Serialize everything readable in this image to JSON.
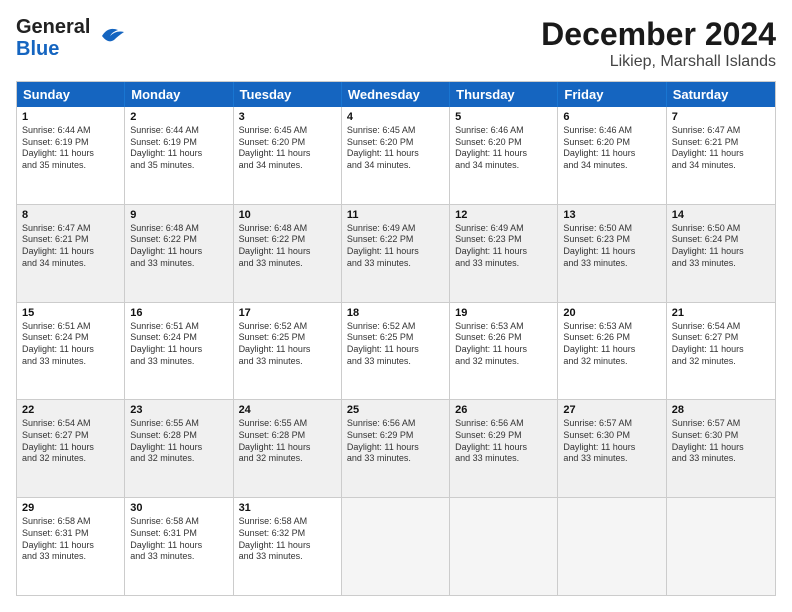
{
  "header": {
    "logo_general": "General",
    "logo_blue": "Blue",
    "month": "December 2024",
    "location": "Likiep, Marshall Islands"
  },
  "days": [
    "Sunday",
    "Monday",
    "Tuesday",
    "Wednesday",
    "Thursday",
    "Friday",
    "Saturday"
  ],
  "weeks": [
    [
      {
        "day": "1",
        "info": "Sunrise: 6:44 AM\nSunset: 6:19 PM\nDaylight: 11 hours\nand 35 minutes."
      },
      {
        "day": "2",
        "info": "Sunrise: 6:44 AM\nSunset: 6:19 PM\nDaylight: 11 hours\nand 35 minutes."
      },
      {
        "day": "3",
        "info": "Sunrise: 6:45 AM\nSunset: 6:20 PM\nDaylight: 11 hours\nand 34 minutes."
      },
      {
        "day": "4",
        "info": "Sunrise: 6:45 AM\nSunset: 6:20 PM\nDaylight: 11 hours\nand 34 minutes."
      },
      {
        "day": "5",
        "info": "Sunrise: 6:46 AM\nSunset: 6:20 PM\nDaylight: 11 hours\nand 34 minutes."
      },
      {
        "day": "6",
        "info": "Sunrise: 6:46 AM\nSunset: 6:20 PM\nDaylight: 11 hours\nand 34 minutes."
      },
      {
        "day": "7",
        "info": "Sunrise: 6:47 AM\nSunset: 6:21 PM\nDaylight: 11 hours\nand 34 minutes."
      }
    ],
    [
      {
        "day": "8",
        "info": "Sunrise: 6:47 AM\nSunset: 6:21 PM\nDaylight: 11 hours\nand 34 minutes."
      },
      {
        "day": "9",
        "info": "Sunrise: 6:48 AM\nSunset: 6:22 PM\nDaylight: 11 hours\nand 33 minutes."
      },
      {
        "day": "10",
        "info": "Sunrise: 6:48 AM\nSunset: 6:22 PM\nDaylight: 11 hours\nand 33 minutes."
      },
      {
        "day": "11",
        "info": "Sunrise: 6:49 AM\nSunset: 6:22 PM\nDaylight: 11 hours\nand 33 minutes."
      },
      {
        "day": "12",
        "info": "Sunrise: 6:49 AM\nSunset: 6:23 PM\nDaylight: 11 hours\nand 33 minutes."
      },
      {
        "day": "13",
        "info": "Sunrise: 6:50 AM\nSunset: 6:23 PM\nDaylight: 11 hours\nand 33 minutes."
      },
      {
        "day": "14",
        "info": "Sunrise: 6:50 AM\nSunset: 6:24 PM\nDaylight: 11 hours\nand 33 minutes."
      }
    ],
    [
      {
        "day": "15",
        "info": "Sunrise: 6:51 AM\nSunset: 6:24 PM\nDaylight: 11 hours\nand 33 minutes."
      },
      {
        "day": "16",
        "info": "Sunrise: 6:51 AM\nSunset: 6:24 PM\nDaylight: 11 hours\nand 33 minutes."
      },
      {
        "day": "17",
        "info": "Sunrise: 6:52 AM\nSunset: 6:25 PM\nDaylight: 11 hours\nand 33 minutes."
      },
      {
        "day": "18",
        "info": "Sunrise: 6:52 AM\nSunset: 6:25 PM\nDaylight: 11 hours\nand 33 minutes."
      },
      {
        "day": "19",
        "info": "Sunrise: 6:53 AM\nSunset: 6:26 PM\nDaylight: 11 hours\nand 32 minutes."
      },
      {
        "day": "20",
        "info": "Sunrise: 6:53 AM\nSunset: 6:26 PM\nDaylight: 11 hours\nand 32 minutes."
      },
      {
        "day": "21",
        "info": "Sunrise: 6:54 AM\nSunset: 6:27 PM\nDaylight: 11 hours\nand 32 minutes."
      }
    ],
    [
      {
        "day": "22",
        "info": "Sunrise: 6:54 AM\nSunset: 6:27 PM\nDaylight: 11 hours\nand 32 minutes."
      },
      {
        "day": "23",
        "info": "Sunrise: 6:55 AM\nSunset: 6:28 PM\nDaylight: 11 hours\nand 32 minutes."
      },
      {
        "day": "24",
        "info": "Sunrise: 6:55 AM\nSunset: 6:28 PM\nDaylight: 11 hours\nand 32 minutes."
      },
      {
        "day": "25",
        "info": "Sunrise: 6:56 AM\nSunset: 6:29 PM\nDaylight: 11 hours\nand 33 minutes."
      },
      {
        "day": "26",
        "info": "Sunrise: 6:56 AM\nSunset: 6:29 PM\nDaylight: 11 hours\nand 33 minutes."
      },
      {
        "day": "27",
        "info": "Sunrise: 6:57 AM\nSunset: 6:30 PM\nDaylight: 11 hours\nand 33 minutes."
      },
      {
        "day": "28",
        "info": "Sunrise: 6:57 AM\nSunset: 6:30 PM\nDaylight: 11 hours\nand 33 minutes."
      }
    ],
    [
      {
        "day": "29",
        "info": "Sunrise: 6:58 AM\nSunset: 6:31 PM\nDaylight: 11 hours\nand 33 minutes."
      },
      {
        "day": "30",
        "info": "Sunrise: 6:58 AM\nSunset: 6:31 PM\nDaylight: 11 hours\nand 33 minutes."
      },
      {
        "day": "31",
        "info": "Sunrise: 6:58 AM\nSunset: 6:32 PM\nDaylight: 11 hours\nand 33 minutes."
      },
      {
        "day": "",
        "info": ""
      },
      {
        "day": "",
        "info": ""
      },
      {
        "day": "",
        "info": ""
      },
      {
        "day": "",
        "info": ""
      }
    ]
  ]
}
